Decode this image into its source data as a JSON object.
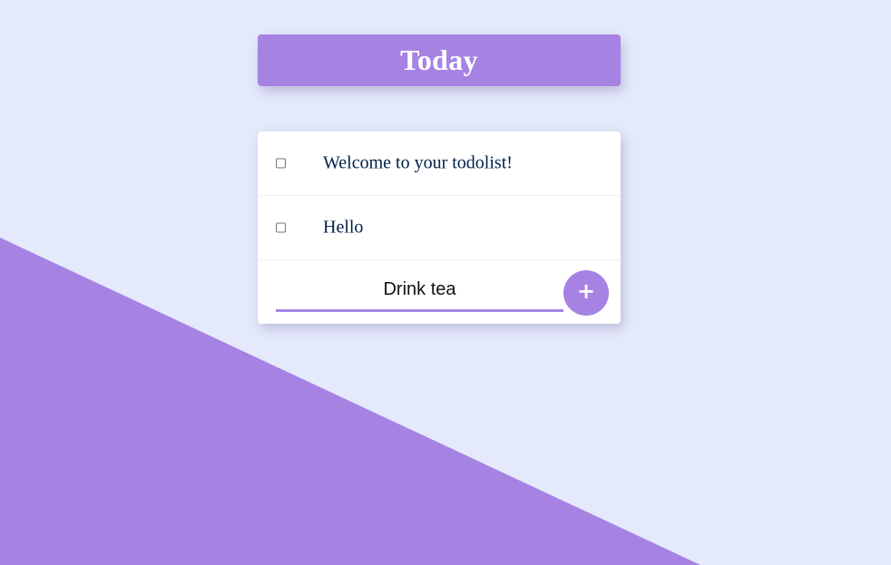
{
  "heading": {
    "title": "Today"
  },
  "todo_list": {
    "items": [
      {
        "label": "Welcome to your todolist!",
        "checked": false
      },
      {
        "label": "Hello",
        "checked": false
      }
    ]
  },
  "new_item": {
    "value": "Drink tea",
    "add_button_label": "+"
  },
  "colors": {
    "background": "#E4E9FB",
    "accent": "#A683E3",
    "text": "#00204A",
    "card": "#FFFFFF"
  },
  "icons": {
    "add": "plus-icon",
    "checkbox": "checkbox-unchecked"
  }
}
